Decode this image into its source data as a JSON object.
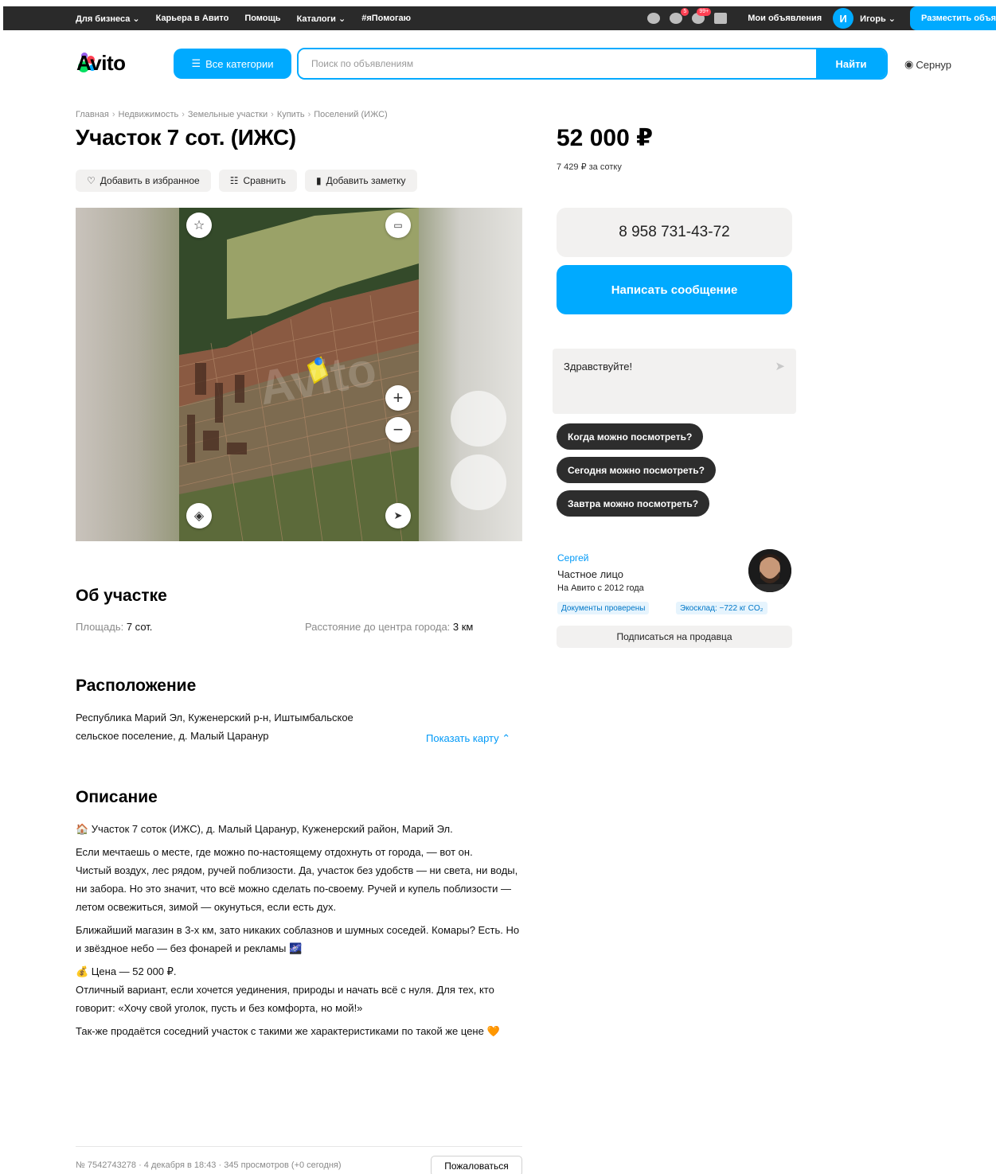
{
  "topbar": {
    "links": [
      "Для бизнеса ⌄",
      "Карьера в Авито",
      "Помощь",
      "Каталоги ⌄",
      "#яПомогаю"
    ],
    "badge2": "5",
    "badge3": "99+",
    "my_ads": "Мои объявления",
    "avatar_letter": "И",
    "user": "Игорь ⌄",
    "post_ad": "Разместить объявление"
  },
  "header": {
    "logo": "Avito",
    "all_categories": "Все категории",
    "search_placeholder": "Поиск по объявлениям",
    "search_button": "Найти",
    "location": "Сернур"
  },
  "breadcrumb": [
    "Главная",
    "Недвижимость",
    "Земельные участки",
    "Купить",
    "Поселений (ИЖС)"
  ],
  "title": "Участок 7 сот. (ИЖС)",
  "actions": {
    "favorite": "Добавить в избранное",
    "compare": "Сравнить",
    "note": "Добавить заметку"
  },
  "price": {
    "value": "52 000 ₽",
    "per_sotka": "7 429 ₽ за сотку"
  },
  "contact": {
    "phone": "8 958 731-43-72",
    "message_button": "Написать сообщение",
    "chat_text": "Здравствуйте!",
    "quick_questions": [
      "Когда можно посмотреть?",
      "Сегодня можно посмотреть?",
      "Завтра можно посмотреть?"
    ]
  },
  "seller": {
    "name": "Сергей",
    "type": "Частное лицо",
    "since": "На Авито с 2012 года",
    "tags": [
      "Документы проверены",
      "Экосклад: −722 кг CO₂"
    ],
    "subscribe": "Подписаться на продавца"
  },
  "about": {
    "heading": "Об участке",
    "area_label": "Площадь:",
    "area_value": "7 сот.",
    "distance_label": "Расстояние до центра города:",
    "distance_value": "3 км"
  },
  "location": {
    "heading": "Расположение",
    "address_line1": "Республика Марий Эл, Куженерский р-н, Иштымбальское",
    "address_line2": "сельское поселение, д. Малый Царанур",
    "show_map": "Показать карту ⌃"
  },
  "description": {
    "heading": "Описание",
    "p1": "🏠 Участок 7 соток (ИЖС), д. Малый Царанур, Куженерский район, Марий Эл.",
    "p2": "Если мечтаешь о месте, где можно по-настоящему отдохнуть от города, — вот он.",
    "p3": "Чистый воздух, лес рядом, ручей поблизости. Да, участок без удобств — ни света, ни воды, ни забора. Но это значит, что всё можно сделать по-своему. Ручей и купель поблизости — летом освежиться, зимой — окунуться, если есть дух.",
    "p4": "Ближайший магазин в 3-х км, зато никаких соблазнов и шумных соседей. Комары? Есть. Но и звёздное небо — без фонарей и рекламы 🌌",
    "p5": "💰 Цена — 52 000 ₽.",
    "p6": "Отличный вариант, если хочется уединения, природы и начать всё с нуля. Для тех, кто говорит: «Хочу свой уголок, пусть и без комфорта, но мой!»",
    "p7": "Так-же продаётся соседний участок с такими же характеристиками по такой же цене 🧡"
  },
  "footer": {
    "meta": "№ 7542743278 · 4 декабря в 18:43 · 345 просмотров (+0 сегодня)",
    "complain": "Пожаловаться"
  },
  "colors": {
    "accent": "#00aaff",
    "dark": "#2d2d2d",
    "surface": "#f2f1f0",
    "link": "#0099f7"
  },
  "icons": [
    "heart-icon",
    "compare-icon",
    "note-icon",
    "star-icon",
    "ruler-icon",
    "zoom-in-icon",
    "zoom-out-icon",
    "layers-icon",
    "locate-icon",
    "send-icon",
    "pin-icon",
    "bell-icon",
    "chat-icon",
    "cart-icon",
    "menu-icon"
  ]
}
